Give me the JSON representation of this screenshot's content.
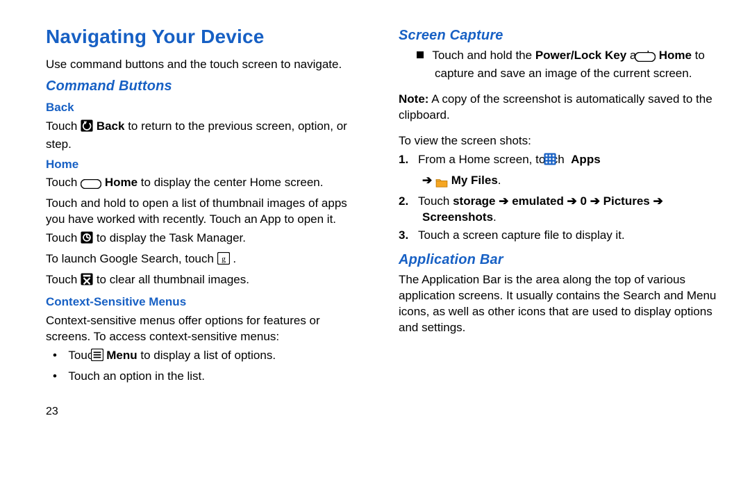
{
  "page_number": "23",
  "left": {
    "title": "Navigating Your Device",
    "intro": "Use command buttons and the touch screen to navigate.",
    "section1": "Command Buttons",
    "back": {
      "h": "Back",
      "t1a": "Touch ",
      "t1b": " Back",
      "t1c": " to return to the previous screen, option, or step."
    },
    "home": {
      "h": "Home",
      "l1a": "Touch ",
      "l1b": " Home",
      "l1c": " to display the center Home screen.",
      "l2": "Touch and hold to open a list of thumbnail images of apps you have worked with recently. Touch an App to open it.",
      "l3a": "Touch ",
      "l3b": " to display the Task Manager.",
      "l4a": "To launch Google Search, touch ",
      "l4b": " .",
      "l5a": "Touch ",
      "l5b": " to clear all thumbnail images."
    },
    "ctx": {
      "h": "Context-Sensitive Menus",
      "p": "Context-sensitive menus offer options for features or screens. To access context-sensitive menus:",
      "b1a": "Touch ",
      "b1b": " Menu",
      "b1c": " to display a list of options.",
      "b2": "Touch an option in the list."
    }
  },
  "right": {
    "sc": {
      "h": "Screen Capture",
      "s1a": "Touch and hold the ",
      "s1b": "Power/Lock Key",
      "s1c": " and ",
      "s1d": " Home",
      "s1e": " to capture and save an image of the current screen.",
      "note_label": "Note:",
      "note": " A copy of the screenshot is automatically saved to the clipboard.",
      "view": "To view the screen shots:",
      "st1a": "From a Home screen, touch ",
      "st1b": " Apps",
      "st1c_arrow": "➔ ",
      "st1d": " My Files",
      "st1e": ".",
      "st2a": "Touch ",
      "st2b": "storage ➔ emulated ➔ 0 ➔ Pictures ➔ Screenshots",
      "st2c": ".",
      "st3": "Touch a screen capture file to display it.",
      "n1": "1.",
      "n2": "2.",
      "n3": "3."
    },
    "ab": {
      "h": "Application Bar",
      "p": "The Application Bar is the area along the top of various application screens. It usually contains the Search and Menu icons, as well as other icons that are used to display options and settings."
    }
  }
}
